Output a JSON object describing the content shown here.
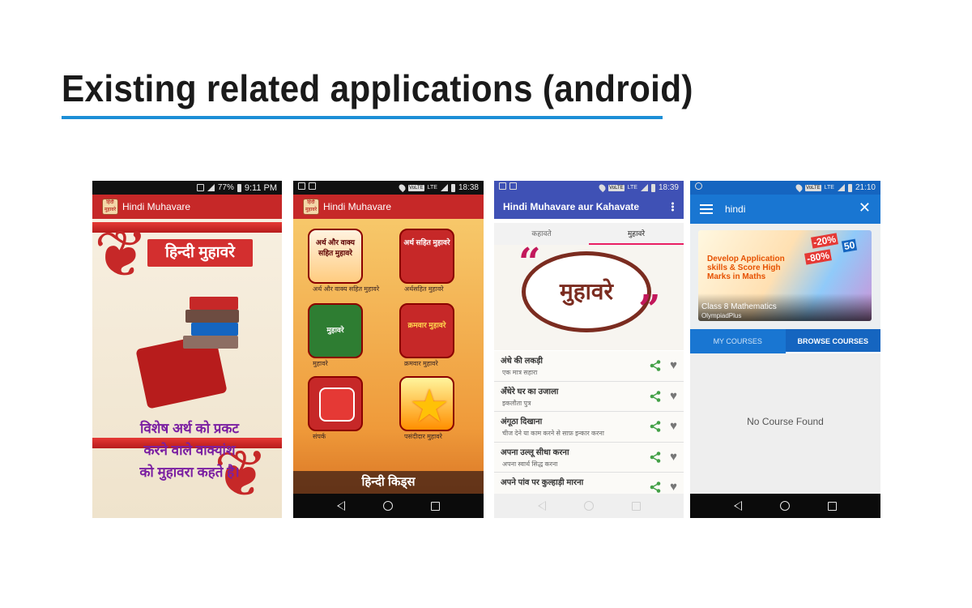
{
  "slide": {
    "title": "Existing related applications (android)"
  },
  "phone1": {
    "status": {
      "time": "9:11 PM",
      "battery": "77%"
    },
    "app_title": "Hindi Muhavare",
    "icon_text": "हिंदी मुहावरे",
    "banner": "हिन्दी मुहावरे",
    "quote": [
      "विशेष अर्थ को प्रकट",
      "करने वाले वाक्यांश",
      "को मुहावरा कहते है।"
    ]
  },
  "phone2": {
    "status": {
      "time": "18:38",
      "network": "LTE"
    },
    "app_title": "Hindi Muhavare",
    "icon_text": "हिंदी मुहावरे",
    "tiles": [
      {
        "label": "अर्थ और वाक्य सहित मुहावरे",
        "art": "अर्थ और वाक्य सहित मुहावरे"
      },
      {
        "label": "अर्थसहित मुहावरे",
        "art": "अर्थ सहित मुहावरे"
      },
      {
        "label": "मुहावरे",
        "art": "मुहावरे"
      },
      {
        "label": "क्रमवार मुहावरे",
        "art": "क्रमवार मुहावरे"
      },
      {
        "label": "संपर्क",
        "art": ""
      },
      {
        "label": "पसंदीदार मुहावरे",
        "art": ""
      }
    ],
    "footer_watermark": "हिन्दी किड्स"
  },
  "phone3": {
    "status": {
      "time": "18:39",
      "network": "LTE"
    },
    "app_title": "Hindi Muhavare aur Kahavate",
    "tabs": [
      "कहावते",
      "मुहावरे"
    ],
    "banner_text": "मुहावरे",
    "items": [
      {
        "title": "अंधे की लकड़ी",
        "meaning": "एक मात्र सहारा"
      },
      {
        "title": "अँधेरे घर का उजाला",
        "meaning": "इकलौता पुत्र"
      },
      {
        "title": "अंगूठा दिखाना",
        "meaning": "चीज देने या काम करने से साफ़ इन्कार करना"
      },
      {
        "title": "अपना उल्लू सीधा करना",
        "meaning": "अपना स्वार्थ सिद्ध करना"
      },
      {
        "title": "अपने पांव पर कुल्हाड़ी मारना",
        "meaning": ""
      }
    ]
  },
  "phone4": {
    "status": {
      "time": "21:10",
      "network": "LTE"
    },
    "search_query": "hindi",
    "course_card": {
      "headline": "Develop Application skills & Score High Marks in Maths",
      "name": "Class 8 Mathematics",
      "provider": "OlympiadPlus",
      "badges": [
        "-20%",
        "-80%",
        "50"
      ]
    },
    "tabs": [
      "MY COURSES",
      "BROWSE COURSES"
    ],
    "empty_message": "No Course Found"
  }
}
